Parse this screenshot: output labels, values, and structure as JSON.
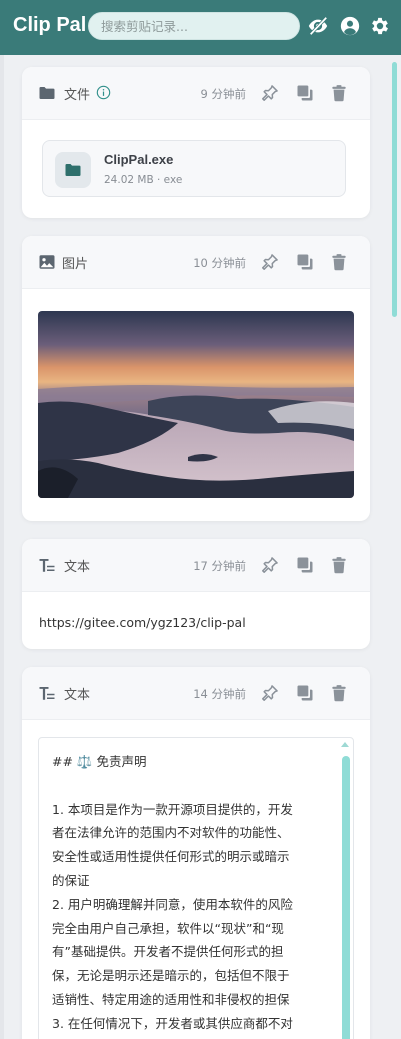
{
  "header": {
    "title": "Clip Pal",
    "search_placeholder": "搜索剪贴记录...",
    "icons": [
      "eye-slash-icon",
      "user-icon",
      "gear-icon"
    ],
    "bg_color": "#3a7b79"
  },
  "cards": [
    {
      "type_label": "文件",
      "time": "9 分钟前",
      "file": {
        "name": "ClipPal.exe",
        "meta": "24.02 MB · exe"
      }
    },
    {
      "type_label": "图片",
      "time": "10 分钟前"
    },
    {
      "type_label": "文本",
      "time": "17 分钟前",
      "content": "https://gitee.com/ygz123/clip-pal"
    },
    {
      "type_label": "文本",
      "time": "14 分钟前",
      "lines": [
        "## ⚖️ 免责声明",
        "",
        "1. 本项目是作为一款开源项目提供的，开发",
        "者在法律允许的范围内不对软件的功能性、",
        "安全性或适用性提供任何形式的明示或暗示",
        "的保证",
        "2. 用户明确理解并同意，使用本软件的风险",
        "完全由用户自己承担，软件以“现状”和“现",
        "有”基础提供。开发者不提供任何形式的担",
        "保，无论是明示还是暗示的，包括但不限于",
        "适销性、特定用途的适用性和非侵权的担保",
        "3. 在任何情况下，开发者或其供应商都不对"
      ]
    }
  ],
  "accent_color": "#8fdcd6"
}
